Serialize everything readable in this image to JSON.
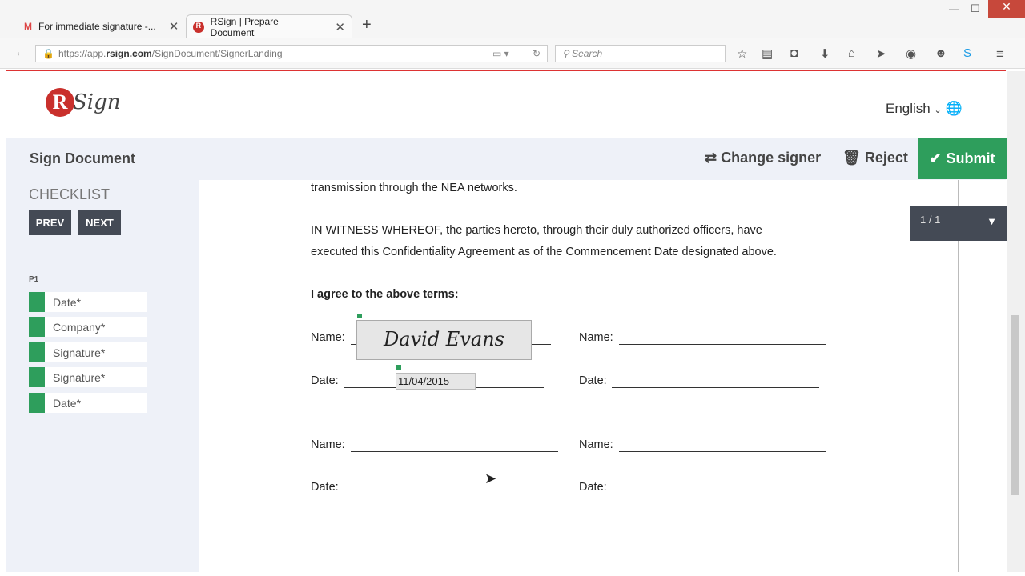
{
  "browser": {
    "tabs": [
      {
        "title": "For immediate signature -..."
      },
      {
        "title": "RSign | Prepare Document"
      }
    ],
    "url_prefix": "https://app.",
    "url_domain": "rsign.com",
    "url_path": "/SignDocument/SignerLanding",
    "search_placeholder": "Search"
  },
  "header": {
    "logo": "RSign",
    "language": "English"
  },
  "toolbar": {
    "title": "Sign Document",
    "change_signer": "Change signer",
    "reject": "Reject",
    "submit": "Submit"
  },
  "sidebar": {
    "checklist": "CHECKLIST",
    "prev": "PREV",
    "next": "NEXT",
    "page": "P1",
    "items": [
      "Date*",
      "Company*",
      "Signature*",
      "Signature*",
      "Date*"
    ]
  },
  "document": {
    "p1": "transmission through the NEA networks.",
    "p2a": "IN WITNESS WHEREOF, the parties hereto, through their duly authorized officers, have",
    "p2b": "executed this Confidentiality Agreement as of the Commencement Date designated above.",
    "agree": "I agree to the above terms:",
    "name_label": "Name:",
    "date_label": "Date:",
    "signature": "David Evans",
    "date_value": "11/04/2015",
    "pager": "1 / 1"
  },
  "colors": {
    "accent": "#2e9e5c",
    "brand": "#c9302c"
  }
}
